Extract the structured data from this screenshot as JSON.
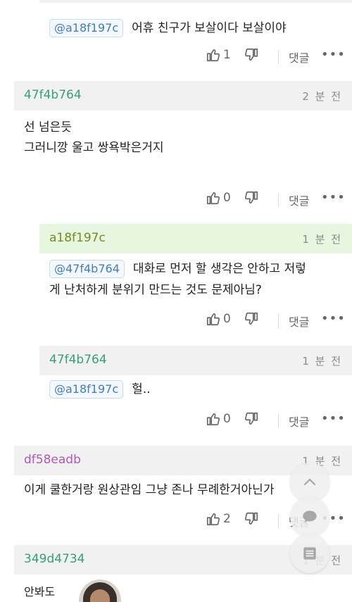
{
  "colors": {
    "header_gray": "#f1f1f1",
    "header_green": "#e6f6df",
    "author_teal": "#35a07a",
    "author_olive": "#7b8a1e",
    "author_purple": "#b05ab8",
    "mention_blue": "#3f7cc4"
  },
  "top_reply": {
    "mention": "@a18f197c",
    "text": "어휴 친구가 보살이다 보살이야",
    "likes": "1",
    "reply_label": "댓글"
  },
  "comments": [
    {
      "author": "47f4b764",
      "time": "2 분 전",
      "lines": [
        "선 넘은듯",
        "그러니깡 울고 쌍욕박은거지"
      ],
      "likes": "0",
      "reply_label": "댓글"
    },
    {
      "author": "a18f197c",
      "time": "1 분 전",
      "mention": "@47f4b764",
      "line1": "대화로 먼저 할 생각은 안하고 저렇",
      "line2": "게 난처하게 분위기 만드는 것도 문제아님?",
      "likes": "0",
      "reply_label": "댓글"
    },
    {
      "author": "47f4b764",
      "time": "1 분 전",
      "mention": "@a18f197c",
      "text": "헐..",
      "likes": "0",
      "reply_label": "댓글"
    },
    {
      "author": "df58eadb",
      "time": "1 분 전",
      "text": "이게 쿨한거랑 원상관임 그냥 존나 무례한거아닌가",
      "likes": "2",
      "reply_label": "댓글"
    },
    {
      "author": "349d4734",
      "time": "1 분 전",
      "text": "안봐도"
    }
  ],
  "icons": {
    "like": "thumbs-up-icon",
    "dislike": "thumbs-down-icon",
    "more": "more-dots-icon",
    "scroll_top": "chevron-up-icon",
    "comment": "comment-bubble-icon",
    "list": "list-icon"
  }
}
